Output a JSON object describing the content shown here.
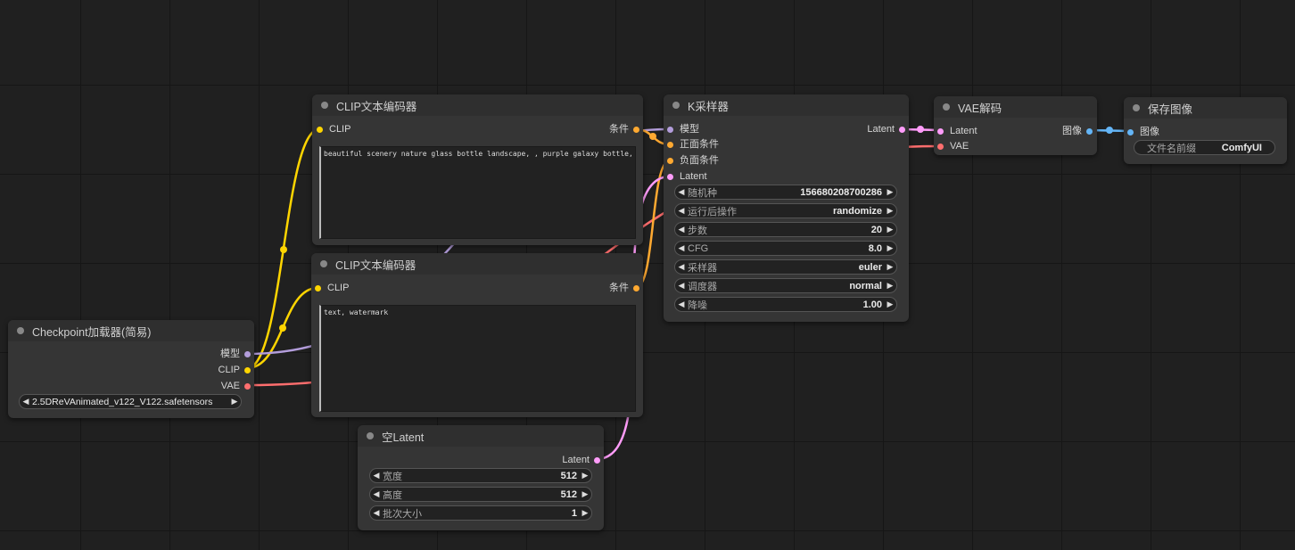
{
  "colors": {
    "clip": "#ffd500",
    "model": "#b39ddb",
    "vae": "#ff6e6e",
    "latent": "#ff9cf9",
    "conditioning": "#ffa931",
    "image": "#64b5f6"
  },
  "nodes": {
    "clip_pos": {
      "title": "CLIP文本编码器",
      "in_clip": "CLIP",
      "out_cond": "条件",
      "text": "beautiful scenery nature glass bottle landscape, , purple galaxy bottle,"
    },
    "clip_neg": {
      "title": "CLIP文本编码器",
      "in_clip": "CLIP",
      "out_cond": "条件",
      "text": "text, watermark"
    },
    "ksampler": {
      "title": "K采样器",
      "inputs": [
        "模型",
        "正面条件",
        "负面条件",
        "Latent"
      ],
      "out_latent": "Latent",
      "widgets": [
        {
          "label": "随机种",
          "value": "156680208700286"
        },
        {
          "label": "运行后操作",
          "value": "randomize"
        },
        {
          "label": "步数",
          "value": "20"
        },
        {
          "label": "CFG",
          "value": "8.0"
        },
        {
          "label": "采样器",
          "value": "euler"
        },
        {
          "label": "调度器",
          "value": "normal"
        },
        {
          "label": "降噪",
          "value": "1.00"
        }
      ]
    },
    "vae_decode": {
      "title": "VAE解码",
      "inputs": [
        "Latent",
        "VAE"
      ],
      "out_image": "图像"
    },
    "save_image": {
      "title": "保存图像",
      "in_image": "图像",
      "widget": {
        "label": "文件名前缀",
        "value": "ComfyUI"
      }
    },
    "checkpoint": {
      "title": "Checkpoint加载器(简易)",
      "outputs": [
        "模型",
        "CLIP",
        "VAE"
      ],
      "widget_value": "2.5DReVAnimated_v122_V122.safetensors"
    },
    "empty_latent": {
      "title": "空Latent",
      "out_latent": "Latent",
      "widgets": [
        {
          "label": "宽度",
          "value": "512"
        },
        {
          "label": "高度",
          "value": "512"
        },
        {
          "label": "批次大小",
          "value": "1"
        }
      ]
    }
  }
}
